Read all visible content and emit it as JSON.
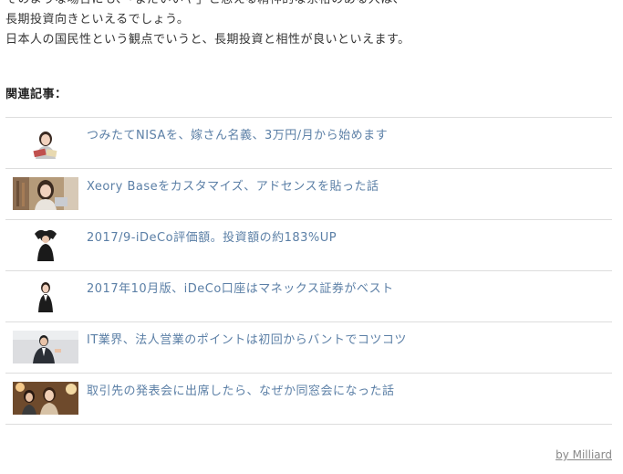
{
  "article": {
    "paragraph_lines": [
      "そのような場合にも、「まだいいや」と思える精神的な余裕のある人は、",
      "長期投資向きといえるでしょう。",
      "日本人の国民性という観点でいうと、長期投資と相性が良いといえます。"
    ]
  },
  "related": {
    "heading": "関連記事：",
    "items": [
      {
        "title": "つみたてNISAを、嫁さん名義、3万円/月から始めます",
        "thumb": "woman-with-money-photo"
      },
      {
        "title": "Xeory Baseをカスタマイズ、アドセンスを貼った話",
        "thumb": "woman-at-laptop-photo"
      },
      {
        "title": "2017/9-iDeCo評価額。投資額の約183%UP",
        "thumb": "man-hands-on-head-photo"
      },
      {
        "title": "2017年10月版、iDeCo口座はマネックス証券がベスト",
        "thumb": "woman-in-suit-photo"
      },
      {
        "title": "IT業界、法人営業のポイントは初回からバントでコツコツ",
        "thumb": "businessman-presenting-photo"
      },
      {
        "title": "取引先の発表会に出席したら、なぜか同窓会になった話",
        "thumb": "party-people-photo"
      }
    ]
  },
  "footer": {
    "credit": "by Milliard"
  },
  "colors": {
    "link": "#5b7fa6",
    "text": "#333333",
    "divider": "#dddddd",
    "credit": "#888888"
  }
}
